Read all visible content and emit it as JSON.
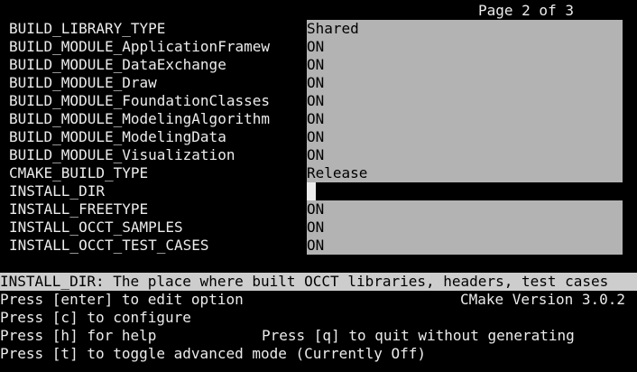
{
  "header": {
    "page_indicator": "Page 2 of 3"
  },
  "options": [
    {
      "name": "BUILD_LIBRARY_TYPE",
      "value": "Shared"
    },
    {
      "name": "BUILD_MODULE_ApplicationFramew",
      "value": "ON"
    },
    {
      "name": "BUILD_MODULE_DataExchange",
      "value": "ON"
    },
    {
      "name": "BUILD_MODULE_Draw",
      "value": "ON"
    },
    {
      "name": "BUILD_MODULE_FoundationClasses",
      "value": "ON"
    },
    {
      "name": "BUILD_MODULE_ModelingAlgorithm",
      "value": "ON"
    },
    {
      "name": "BUILD_MODULE_ModelingData",
      "value": "ON"
    },
    {
      "name": "BUILD_MODULE_Visualization",
      "value": "ON"
    },
    {
      "name": "CMAKE_BUILD_TYPE",
      "value": "Release"
    },
    {
      "name": "INSTALL_DIR",
      "value": ""
    },
    {
      "name": "INSTALL_FREETYPE",
      "value": "ON"
    },
    {
      "name": "INSTALL_OCCT_SAMPLES",
      "value": "ON"
    },
    {
      "name": "INSTALL_OCCT_TEST_CASES",
      "value": "ON"
    }
  ],
  "selected_option": "INSTALL_DIR",
  "description": "INSTALL_DIR: The place where built OCCT libraries, headers, test cases",
  "footer": {
    "edit_hint": "Press [enter] to edit option",
    "cmake_version": "CMake Version 3.0.2",
    "configure_hint": "Press [c] to configure",
    "help_hint": "Press [h] for help",
    "quit_hint": "Press [q] to quit without generating",
    "toggle_hint": "Press [t] to toggle advanced mode (Currently Off)"
  },
  "colors": {
    "background": "#000000",
    "text": "#ececec",
    "value_field": "#b3b3b3",
    "description_bar": "#cdcdcd",
    "cursor": "#ececec"
  }
}
